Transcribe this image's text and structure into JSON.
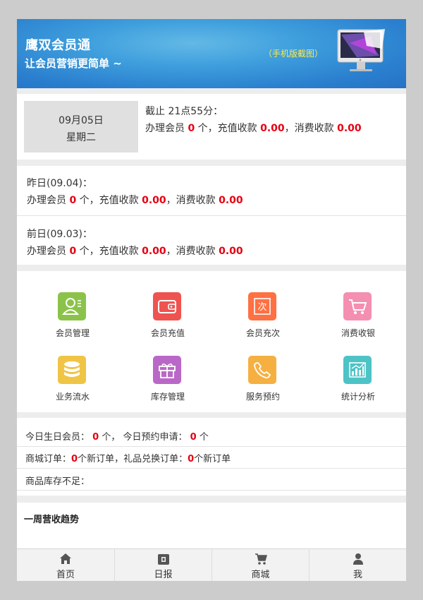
{
  "banner": {
    "title": "鹰双会员通",
    "subtitle": "让会员营销更简单 ~",
    "note": "（手机版截图）"
  },
  "today": {
    "date": "09月05日",
    "weekday": "星期二",
    "as_of": "截止 21点55分：",
    "members_label": "办理会员",
    "members": "0",
    "unit": "个，充值收款",
    "recharge": "0.00",
    "spend_label": "，消费收款",
    "spend": "0.00"
  },
  "history": [
    {
      "title": "昨日(09.04)：",
      "members_label": "办理会员",
      "members": "0",
      "unit": "个，充值收款",
      "recharge": "0.00",
      "spend_label": "，消费收款",
      "spend": "0.00"
    },
    {
      "title": "前日(09.03)：",
      "members_label": "办理会员",
      "members": "0",
      "unit": "个，充值收款",
      "recharge": "0.00",
      "spend_label": "，消费收款",
      "spend": "0.00"
    }
  ],
  "grid": [
    {
      "label": "会员管理",
      "icon": "member-icon",
      "color": "#8bc34a"
    },
    {
      "label": "会员充值",
      "icon": "wallet-icon",
      "color": "#ef5350"
    },
    {
      "label": "会员充次",
      "icon": "count-icon",
      "color": "#ff7043"
    },
    {
      "label": "消费收银",
      "icon": "cart-icon",
      "color": "#f48fb1"
    },
    {
      "label": "业务流水",
      "icon": "coins-icon",
      "color": "#f0c445"
    },
    {
      "label": "库存管理",
      "icon": "gift-icon",
      "color": "#ba68c8"
    },
    {
      "label": "服务预约",
      "icon": "phone-icon",
      "color": "#f5b041"
    },
    {
      "label": "统计分析",
      "icon": "chart-icon",
      "color": "#4dc3c6"
    }
  ],
  "info": {
    "birthday_label": "今日生日会员：",
    "birthday": "0",
    "birthday_unit": "个，",
    "appoint_label": "今日预约申请：",
    "appoint": "0",
    "appoint_unit": "个",
    "mall_label": "商城订单：",
    "mall": "0",
    "mall_unit": "个新订单，礼品兑换订单：",
    "gift": "0",
    "gift_unit": "个新订单",
    "stock_label": "商品库存不足："
  },
  "trend": {
    "title": "一周营收趋势"
  },
  "tabs": [
    {
      "label": "首页",
      "icon": "home-icon"
    },
    {
      "label": "日报",
      "icon": "calendar-icon"
    },
    {
      "label": "商城",
      "icon": "cart-icon"
    },
    {
      "label": "我",
      "icon": "user-icon"
    }
  ],
  "colors": {
    "accent_red": "#e60012",
    "banner_blue": "#3f9fdd"
  }
}
